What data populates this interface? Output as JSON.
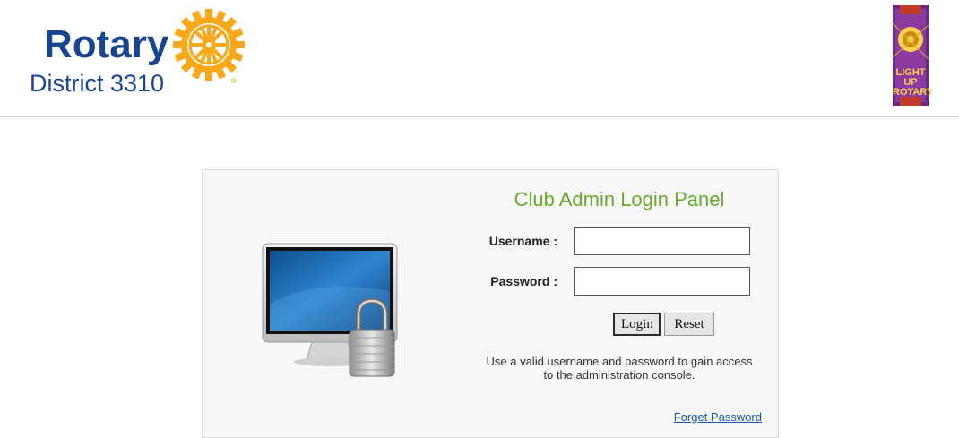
{
  "header": {
    "logo": {
      "wordmark": "Rotary",
      "district": "District 3310",
      "registered": "®"
    },
    "badge": {
      "line1": "LIGHT UP",
      "line2": "ROTARY"
    }
  },
  "login_panel": {
    "title": "Club Admin Login Panel",
    "username_label": "Username :",
    "username_value": "",
    "password_label": "Password :",
    "password_value": "",
    "login_button": "Login",
    "reset_button": "Reset",
    "help_text": "Use a valid username and password to gain access to the administration console.",
    "forget_link": "Forget Password"
  },
  "colors": {
    "rotary_blue": "#17458f",
    "rotary_gold": "#f7a81b",
    "title_green": "#6aab2e",
    "link_blue": "#1a5ab4"
  },
  "icons": {
    "logo_wheel": "rotary-wheel-icon",
    "monitor": "computer-monitor-icon",
    "lock": "padlock-icon"
  }
}
